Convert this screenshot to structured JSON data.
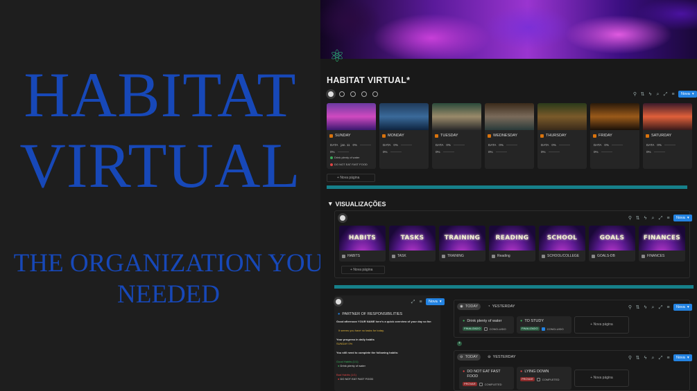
{
  "promo": {
    "title_line1": "HABITAT",
    "title_line2": "VIRTUAL",
    "subtitle_line1": "THE ORGANIZATION YOU",
    "subtitle_line2": "NEEDED"
  },
  "page": {
    "title": "HABITAT VIRTUAL*",
    "icon": "atom-icon"
  },
  "toolbar": {
    "new_label": "Nova"
  },
  "days": [
    {
      "name": "SUNDAY",
      "data_label": "DATA",
      "date": "jan. 11",
      "pct": "0%",
      "pct2": "0%",
      "habits": [
        "Drink plenty of water",
        "DO NOT EAT FAST FOOD"
      ],
      "img": "linear-gradient(180deg,#6a3aa0,#d04ac0 50%,#3a1870)"
    },
    {
      "name": "MONDAY",
      "data_label": "DATA",
      "pct": "0%",
      "pct2": "0%",
      "img": "linear-gradient(180deg,#1f3a5a,#3a6a9a 50%,#0e2440)"
    },
    {
      "name": "TUESDAY",
      "data_label": "DATA",
      "pct": "0%",
      "pct2": "0%",
      "img": "linear-gradient(180deg,#2a4a3a,#9a8a6a 50%,#2a2a2a)"
    },
    {
      "name": "WEDNESDAY",
      "data_label": "DATA",
      "pct": "0%",
      "pct2": "0%",
      "img": "linear-gradient(180deg,#3a2a1a,#7a6a5a 50%,#2a3a3a)"
    },
    {
      "name": "THURSDAY",
      "data_label": "DATA",
      "pct": "0%",
      "pct2": "0%",
      "img": "linear-gradient(180deg,#2a3a1a,#7a5a2a 50%,#3a2a1a)"
    },
    {
      "name": "FRIDAY",
      "data_label": "DATA",
      "pct": "0%",
      "pct2": "0%",
      "img": "linear-gradient(180deg,#2a1a0a,#9a5a1a 50%,#1a1008)"
    },
    {
      "name": "SATURDAY",
      "data_label": "DATA",
      "pct": "0%",
      "pct2": "0%",
      "img": "linear-gradient(180deg,#3a1a2a,#e0603a 50%,#3a1a1a)"
    }
  ],
  "new_page": "Nova página",
  "visualizacoes": {
    "title": "VISUALIZAÇÕES",
    "cards": [
      {
        "banner": "HABITS",
        "label": "HABITS"
      },
      {
        "banner": "TASKS",
        "label": "TASK"
      },
      {
        "banner": "TRAINING",
        "label": "TRAINING"
      },
      {
        "banner": "READING",
        "label": "Reading"
      },
      {
        "banner": "SCHOOL",
        "label": "SCHOOL/COLLEGE"
      },
      {
        "banner": "GOALS",
        "label": "GOALS-DB"
      },
      {
        "banner": "FINANCES",
        "label": "FINANCES"
      }
    ]
  },
  "partner": {
    "title": "PARTNER OF RESPONSIBILITIES",
    "greeting": "Good afternoon YOUR NAME here's a quick overview of your day so far:",
    "no_tasks": "It seems you have no tasks for today.",
    "progress_title": "Your progress in daily habits",
    "progress_value": "SUNDAY  0%",
    "complete_title": "You still need to complete the following habits:",
    "good_label": "Good Habits (1/1)",
    "good_item": "Drink plenty of water",
    "bad_label": "Bad Habits (1/1)",
    "bad_item": "DO NOT EAT FAST FOOD"
  },
  "boards": {
    "today": "TODAY",
    "yesterday": "YESTERDAY",
    "top_cards": [
      {
        "title": "Drink plenty of water",
        "tag": "FINALIZADO",
        "check_label": "CONCLUIDO",
        "checked": false
      },
      {
        "title": "TO STUDY",
        "tag": "FINALIZADO",
        "check_label": "CONCLUIDO",
        "checked": true
      }
    ],
    "bottom_cards": [
      {
        "title_line1": "DO NOT EAT FAST",
        "title_line2": "FOOD",
        "tag": "PROVAR",
        "check_label": "COMPLETED"
      },
      {
        "title_line1": "LYING DOWN",
        "title_line2": "",
        "tag": "PROVAR",
        "check_label": "COMPLETED"
      }
    ]
  }
}
